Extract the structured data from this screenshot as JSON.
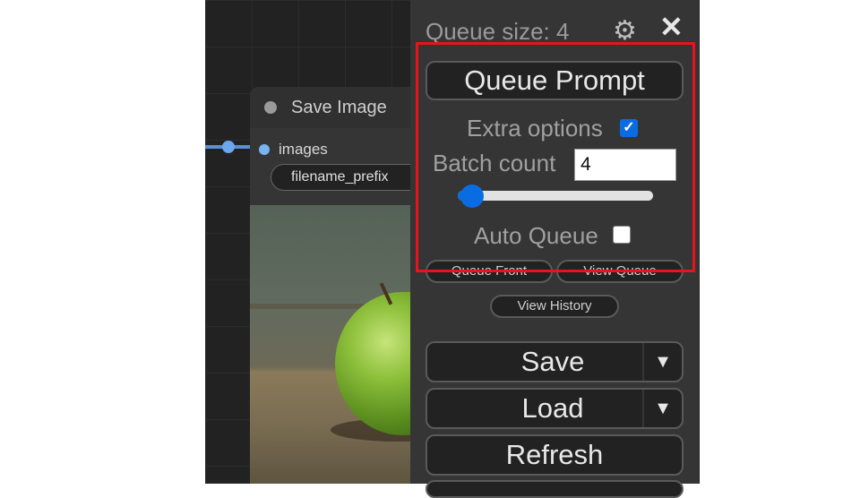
{
  "node": {
    "title": "Save Image",
    "input_label": "images",
    "widget_label": "filename_prefix"
  },
  "panel": {
    "queue_size": "Queue size: 4",
    "queue_prompt": "Queue Prompt",
    "extra_options_label": "Extra options",
    "extra_options_checked": true,
    "batch_count_label": "Batch count",
    "batch_count_value": "4",
    "batch_slider_fraction": 0.05,
    "auto_queue_label": "Auto Queue",
    "auto_queue_checked": false,
    "queue_front": "Queue Front",
    "view_queue": "View Queue",
    "view_history": "View History",
    "save": "Save",
    "load": "Load",
    "refresh": "Refresh"
  },
  "icons": {
    "settings": "gear-icon",
    "close": "close-icon",
    "dropdown": "chevron-down-icon",
    "checkmark": "check-icon"
  },
  "colors": {
    "accent": "#0a6ce3",
    "highlight": "#e8141c",
    "panel_bg": "#353535",
    "canvas_bg": "#222222"
  }
}
